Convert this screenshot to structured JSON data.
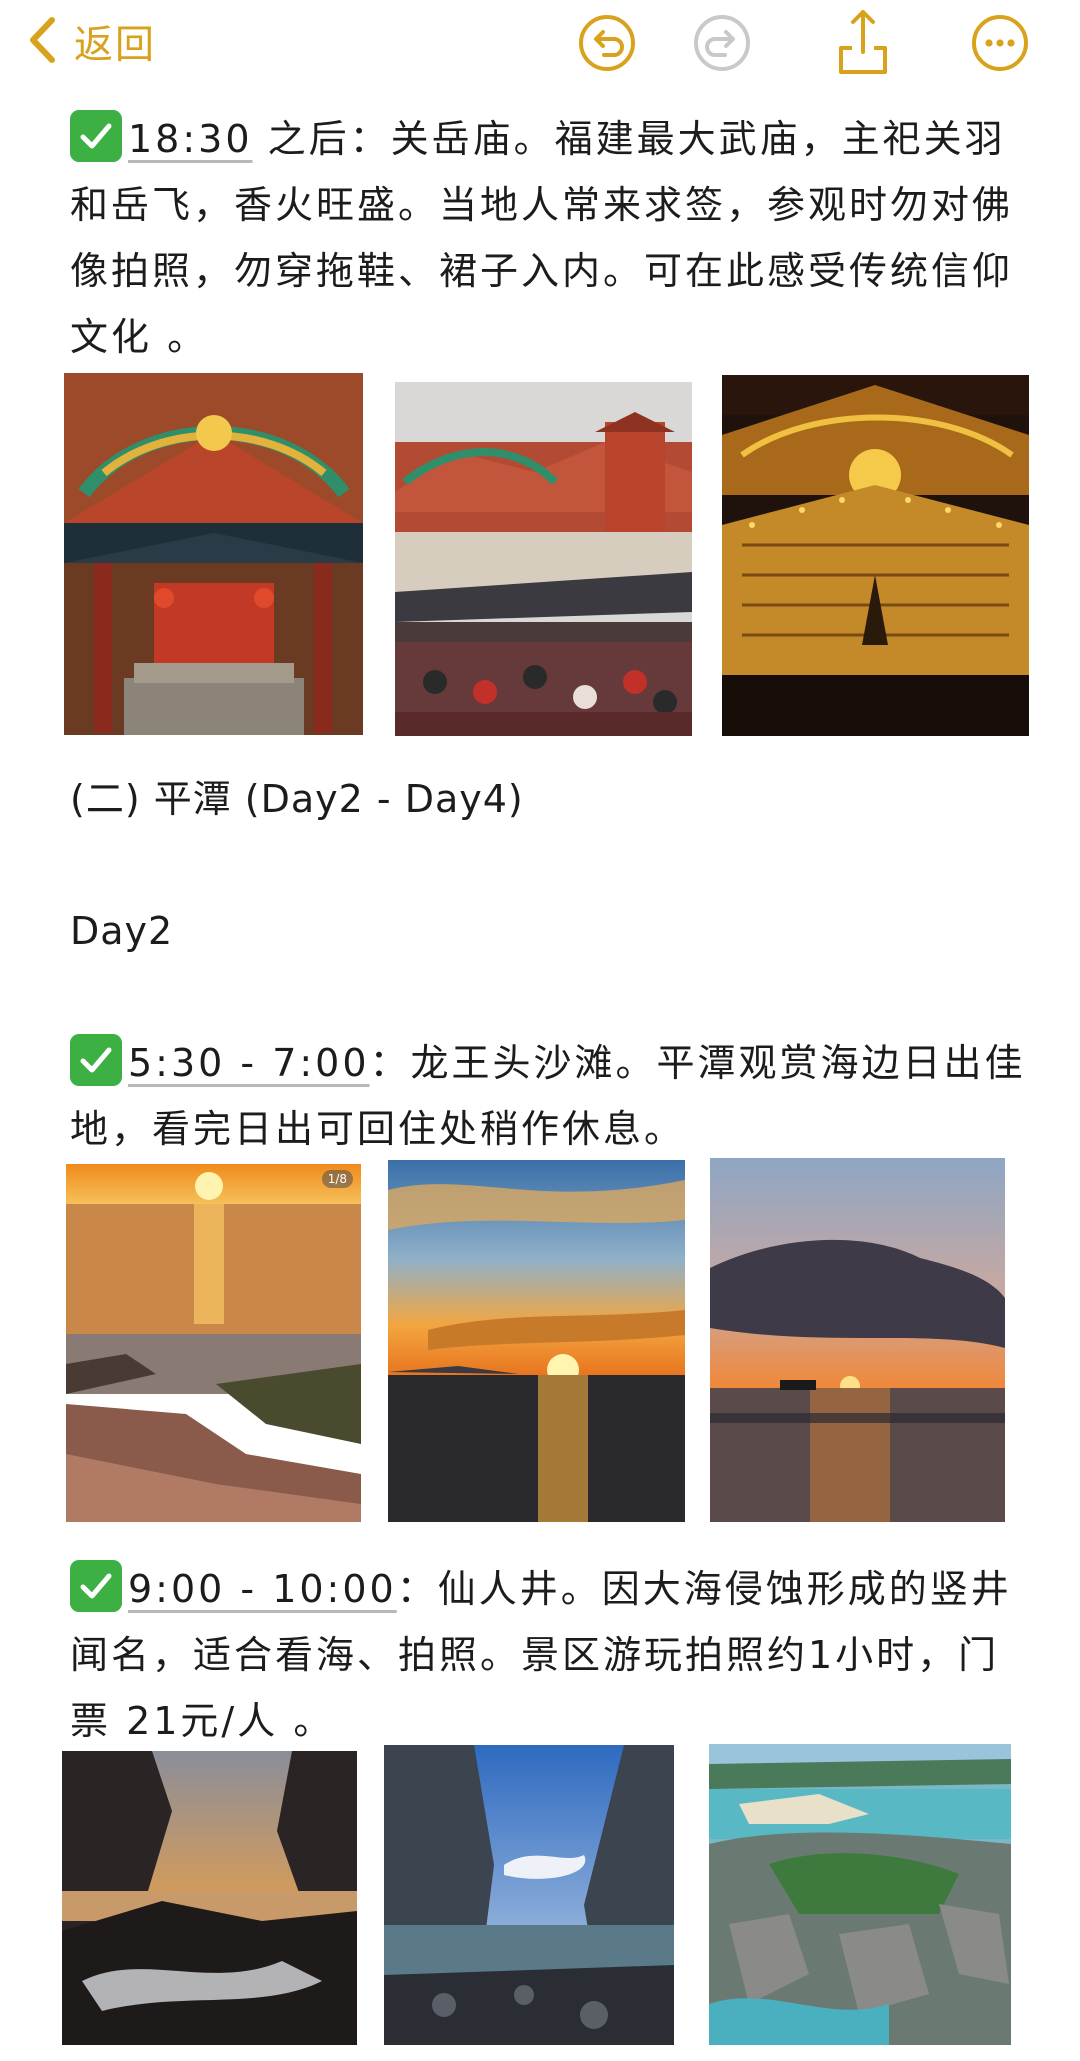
{
  "toolbar": {
    "back_label": "返回"
  },
  "colors": {
    "accent": "#d9a21c",
    "check_green": "#3cb043"
  },
  "icons": [
    "chevron-left-icon",
    "undo-icon",
    "redo-icon",
    "share-icon",
    "more-icon",
    "check-mark-icon"
  ],
  "note": {
    "block1": {
      "time": "18:30",
      "text": " 之后：关岳庙。福建最大武庙，主祀关羽和岳飞，香火旺盛。当地人常来求签，参观时勿对佛像拍照，勿穿拖鞋、裙子入内。可在此感受传统信仰文化 。"
    },
    "section_heading": "(二) 平潭 (Day2 - Day4)",
    "day_heading": "Day2",
    "block2": {
      "time": "5:30 - 7:00",
      "text": "：龙王头沙滩。平潭观赏海边日出佳地，看完日出可回住处稍作休息。"
    },
    "block3": {
      "time": "9:00 - 10:00",
      "text": "：仙人井。因大海侵蚀形成的竖井闻名，适合看海、拍照。景区游玩拍照约1小时，门票 21元/人 。"
    },
    "photo_badge": "1/8"
  }
}
